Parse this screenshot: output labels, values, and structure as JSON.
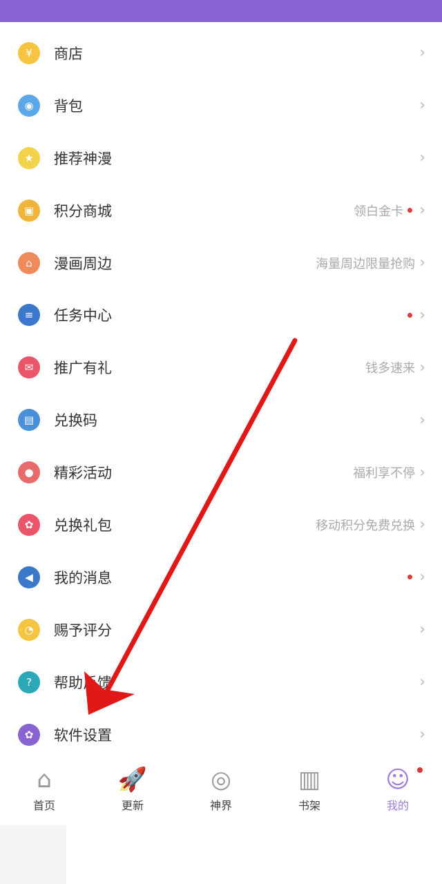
{
  "menu": [
    {
      "label": "商店",
      "hint": "",
      "dot": false,
      "icon": "coin-icon",
      "color": "#f5c542",
      "glyph": "¥"
    },
    {
      "label": "背包",
      "hint": "",
      "dot": false,
      "icon": "backpack-icon",
      "color": "#5aa8e8",
      "glyph": "◉"
    },
    {
      "label": "推荐神漫",
      "hint": "",
      "dot": false,
      "icon": "award-icon",
      "color": "#f3d34a",
      "glyph": "★"
    },
    {
      "label": "积分商城",
      "hint": "领白金卡",
      "dot": true,
      "icon": "treasure-chest-icon",
      "color": "#f0b43c",
      "glyph": "▣"
    },
    {
      "label": "漫画周边",
      "hint": "海量周边限量抢购",
      "dot": false,
      "icon": "shop-icon",
      "color": "#ef8a5a",
      "glyph": "⌂"
    },
    {
      "label": "任务中心",
      "hint": "",
      "dot": true,
      "icon": "task-list-icon",
      "color": "#3b78c9",
      "glyph": "≡"
    },
    {
      "label": "推广有礼",
      "hint": "钱多速来",
      "dot": false,
      "icon": "envelope-icon",
      "color": "#e9566a",
      "glyph": "✉"
    },
    {
      "label": "兑换码",
      "hint": "",
      "dot": false,
      "icon": "ticket-icon",
      "color": "#4a90d9",
      "glyph": "▤"
    },
    {
      "label": "精彩活动",
      "hint": "福利享不停",
      "dot": false,
      "icon": "balloons-icon",
      "color": "#e86b6b",
      "glyph": "●"
    },
    {
      "label": "兑换礼包",
      "hint": "移动积分免费兑换",
      "dot": false,
      "icon": "gift-bag-icon",
      "color": "#e9566a",
      "glyph": "✿"
    },
    {
      "label": "我的消息",
      "hint": "",
      "dot": true,
      "icon": "megaphone-icon",
      "color": "#3b78c9",
      "glyph": "◀"
    },
    {
      "label": "赐予评分",
      "hint": "",
      "dot": false,
      "icon": "pie-chart-icon",
      "color": "#f3c542",
      "glyph": "◔"
    },
    {
      "label": "帮助反馈",
      "hint": "",
      "dot": false,
      "icon": "help-feedback-icon",
      "color": "#2aa8b8",
      "glyph": "?"
    },
    {
      "label": "软件设置",
      "hint": "",
      "dot": false,
      "icon": "gear-icon",
      "color": "#8a63d2",
      "glyph": "✿"
    }
  ],
  "chevron": "›",
  "tabs": [
    {
      "label": "首页",
      "icon": "home-icon",
      "glyph": "⌂",
      "active": false
    },
    {
      "label": "更新",
      "icon": "rocket-icon",
      "glyph": "🚀",
      "active": false
    },
    {
      "label": "神界",
      "icon": "cloud-swirl-icon",
      "glyph": "◎",
      "active": false
    },
    {
      "label": "书架",
      "icon": "bookshelf-icon",
      "glyph": "▥",
      "active": false
    },
    {
      "label": "我的",
      "icon": "profile-avatar-icon",
      "glyph": "☺",
      "active": true,
      "dot": true
    }
  ],
  "colors": {
    "header": "#8a63d2",
    "accent": "#9a7fe0",
    "badge": "#e03a3a",
    "arrow": "#e01818"
  }
}
